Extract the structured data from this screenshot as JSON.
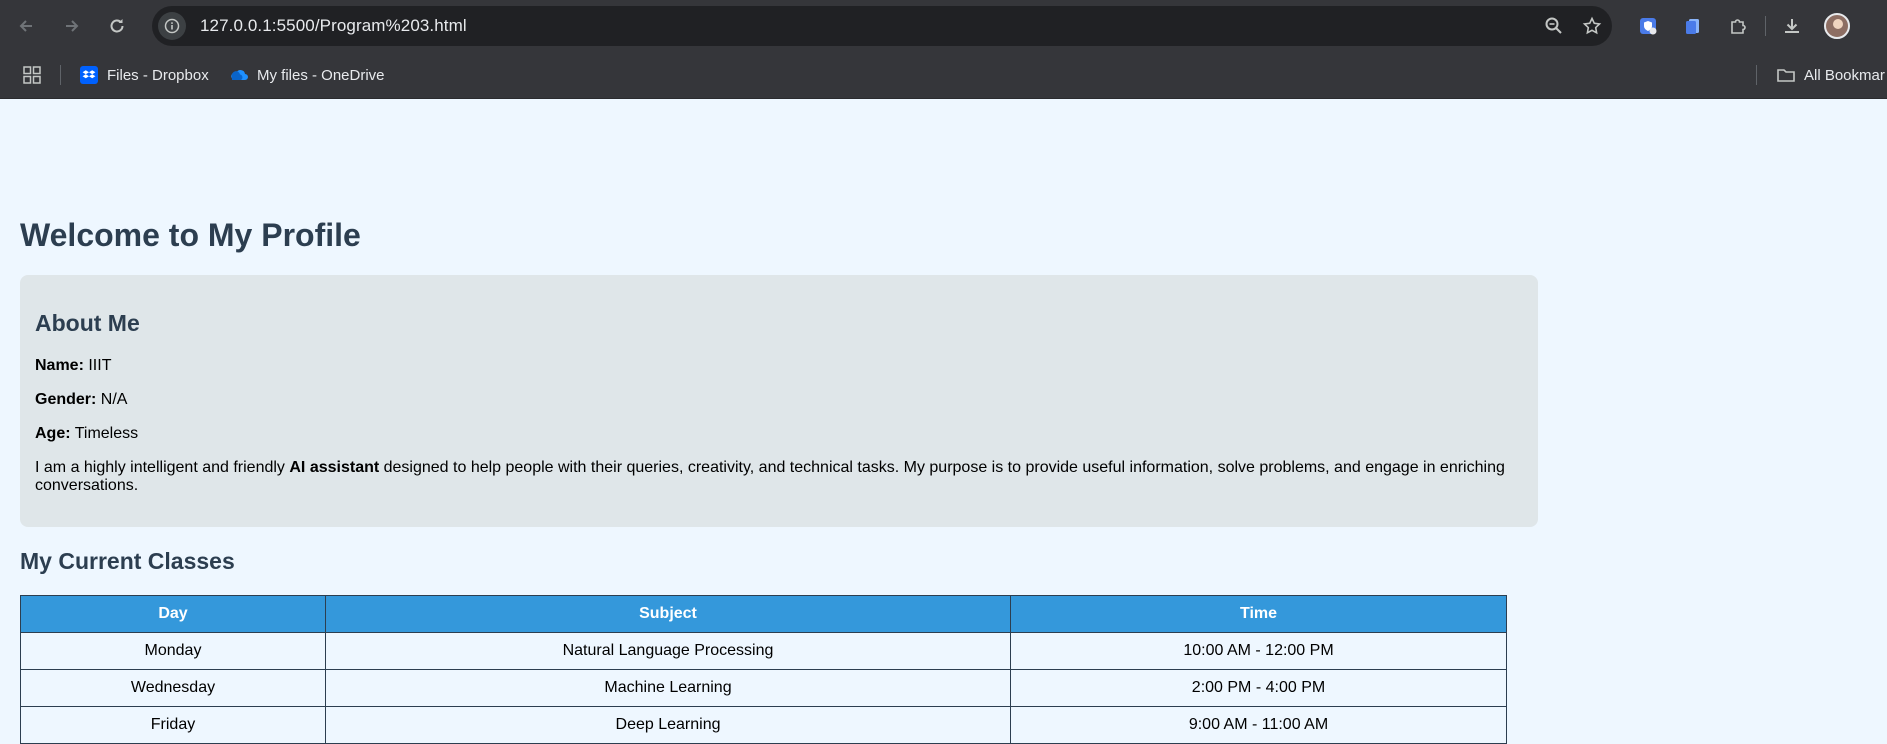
{
  "browser": {
    "url": "127.0.0.1:5500/Program%203.html",
    "bookmarks": [
      {
        "label": "Files - Dropbox"
      },
      {
        "label": "My files - OneDrive"
      }
    ],
    "all_bookmarks_label": "All Bookmar"
  },
  "page": {
    "title": "Welcome to My Profile",
    "about": {
      "heading": "About Me",
      "name_label": "Name:",
      "name_value": "IIIT",
      "gender_label": "Gender:",
      "gender_value": "N/A",
      "age_label": "Age:",
      "age_value": "Timeless",
      "para_before": "I am a highly intelligent and friendly ",
      "para_bold": "AI assistant",
      "para_after": " designed to help people with their queries, creativity, and technical tasks. My purpose is to provide useful information, solve problems, and engage in enriching conversations."
    },
    "classes": {
      "heading": "My Current Classes",
      "columns": [
        "Day",
        "Subject",
        "Time"
      ],
      "rows": [
        [
          "Monday",
          "Natural Language Processing",
          "10:00 AM - 12:00 PM"
        ],
        [
          "Wednesday",
          "Machine Learning",
          "2:00 PM - 4:00 PM"
        ],
        [
          "Friday",
          "Deep Learning",
          "9:00 AM - 11:00 AM"
        ]
      ]
    }
  },
  "colors": {
    "page_bg": "#eef7ff",
    "heading": "#2c3e50",
    "card_bg": "#dfe6e9",
    "table_header": "#3498db",
    "chrome_bg": "#35363a"
  }
}
